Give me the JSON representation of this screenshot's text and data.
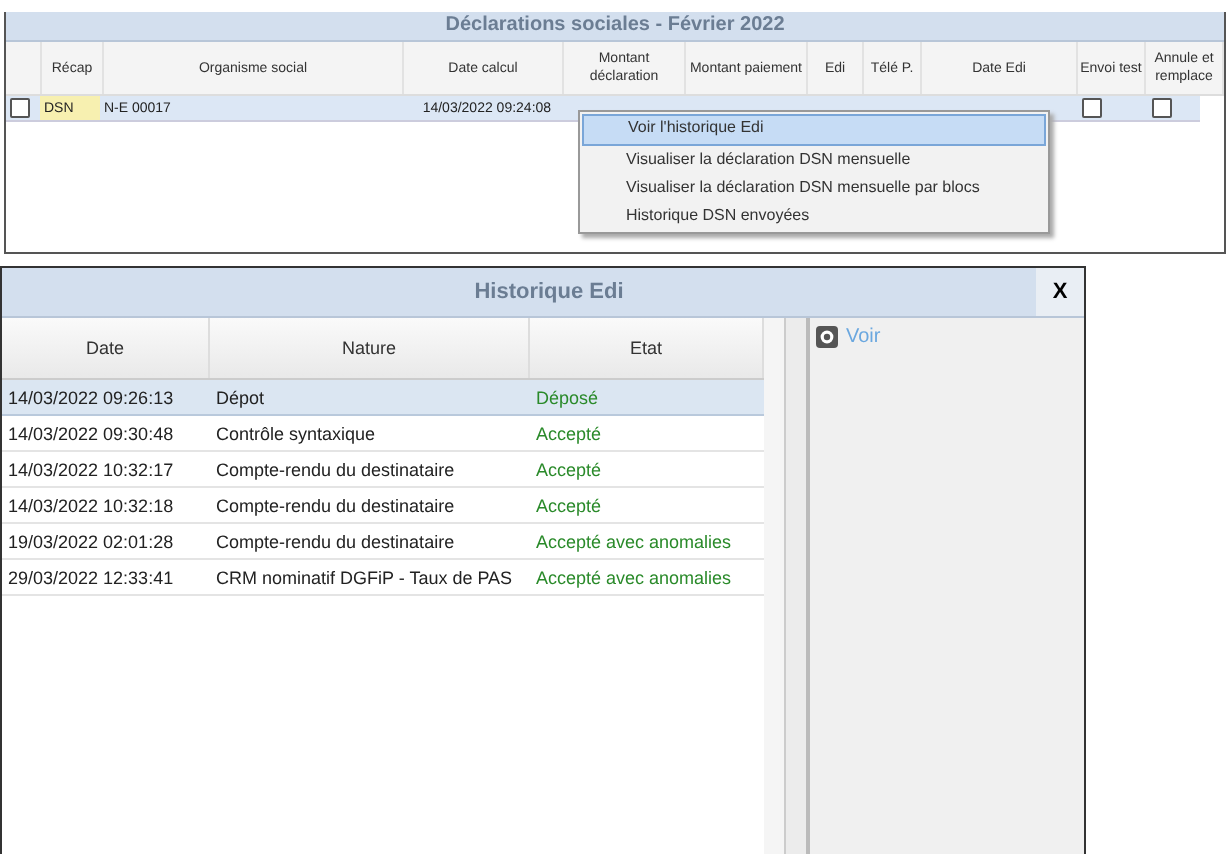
{
  "declarations": {
    "title": "Déclarations sociales - Février 2022",
    "columns": [
      "Récap",
      "Organisme social",
      "Date calcul",
      "Montant déclaration",
      "Montant paiement",
      "Edi",
      "Télé P.",
      "Date Edi",
      "Envoi test",
      "Annule et remplace"
    ],
    "rows": [
      {
        "selected": true,
        "checked": false,
        "recap": "DSN",
        "organisme": "N-E  00017",
        "date_calcul": "14/03/2022 09:24:08",
        "envoi_test": false,
        "annule_remplace": false
      }
    ]
  },
  "context_menu": {
    "items": [
      {
        "label": "Voir l'historique Edi",
        "selected": true
      },
      {
        "label": "Visualiser la déclaration DSN mensuelle",
        "selected": false
      },
      {
        "label": "Visualiser la déclaration DSN mensuelle par blocs",
        "selected": false
      },
      {
        "label": "Historique DSN envoyées",
        "selected": false
      }
    ]
  },
  "history_window": {
    "title": "Historique Edi",
    "close": "X",
    "columns": [
      "Date",
      "Nature",
      "Etat"
    ],
    "rows": [
      {
        "date": "14/03/2022 09:26:13",
        "nature": "Dépot",
        "etat": "Déposé",
        "selected": true
      },
      {
        "date": "14/03/2022 09:30:48",
        "nature": "Contrôle syntaxique",
        "etat": "Accepté",
        "selected": false
      },
      {
        "date": "14/03/2022 10:32:17",
        "nature": "Compte-rendu du destinataire",
        "etat": "Accepté",
        "selected": false
      },
      {
        "date": "14/03/2022 10:32:18",
        "nature": "Compte-rendu du destinataire",
        "etat": "Accepté",
        "selected": false
      },
      {
        "date": "19/03/2022 02:01:28",
        "nature": "Compte-rendu du destinataire",
        "etat": "Accepté avec anomalies",
        "selected": false
      },
      {
        "date": "29/03/2022 12:33:41",
        "nature": "CRM nominatif DGFiP - Taux de PAS",
        "etat": "Accepté avec anomalies",
        "selected": false
      }
    ],
    "action": "Voir"
  }
}
